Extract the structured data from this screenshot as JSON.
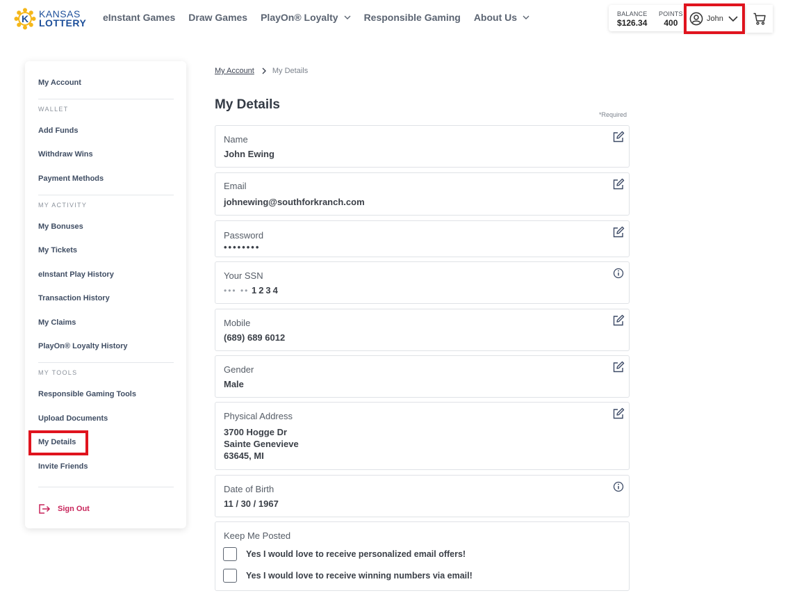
{
  "header": {
    "logo_top": "KANSAS",
    "logo_bottom": "LOTTERY",
    "nav": [
      {
        "label": "eInstant Games",
        "dropdown": false
      },
      {
        "label": "Draw Games",
        "dropdown": false
      },
      {
        "label": "PlayOn® Loyalty",
        "dropdown": true
      },
      {
        "label": "Responsible Gaming",
        "dropdown": false
      },
      {
        "label": "About Us",
        "dropdown": true
      }
    ],
    "balance_label": "BALANCE",
    "balance_value": "$126.34",
    "points_label": "POINTS",
    "points_value": "400",
    "user_name": "John",
    "icons": {
      "user": "user-circle-icon",
      "chevron": "chevron-down-icon",
      "cart": "cart-icon"
    }
  },
  "sidebar": {
    "my_account": "My Account",
    "wallet_label": "WALLET",
    "wallet_items": [
      "Add Funds",
      "Withdraw Wins",
      "Payment Methods"
    ],
    "activity_label": "MY ACTIVITY",
    "activity_items": [
      "My Bonuses",
      "My Tickets",
      "eInstant Play History",
      "Transaction History",
      "My Claims",
      "PlayOn® Loyalty History"
    ],
    "tools_label": "MY TOOLS",
    "tools_items": [
      "Responsible Gaming Tools",
      "Upload Documents",
      "My Details",
      "Invite Friends"
    ],
    "sign_out": "Sign Out"
  },
  "breadcrumb": {
    "parent": "My Account",
    "current": "My Details"
  },
  "main": {
    "title": "My Details",
    "required_note": "*Required",
    "fields": {
      "name": {
        "label": "Name",
        "value": "John Ewing"
      },
      "email": {
        "label": "Email",
        "value": "johnewing@southforkranch.com"
      },
      "password": {
        "label": "Password",
        "value": "••••••••"
      },
      "ssn": {
        "label": "Your SSN",
        "masked": "••• ••",
        "last4": "1234"
      },
      "mobile": {
        "label": "Mobile",
        "value": "(689) 689 6012"
      },
      "gender": {
        "label": "Gender",
        "value": "Male"
      },
      "address": {
        "label": "Physical Address",
        "line1": "3700 Hogge Dr",
        "line2": "Sainte Genevieve",
        "line3": "63645, MI"
      },
      "dob": {
        "label": "Date of Birth",
        "value": "11 / 30 / 1967"
      }
    },
    "keep_posted": {
      "label": "Keep Me Posted",
      "option1": "Yes I would love to receive personalized email offers!",
      "option2": "Yes I would love to receive winning numbers via email!"
    }
  },
  "colors": {
    "highlight": "#e0141e",
    "sign_out": "#c8245a",
    "brand_blue": "#1d4f9a",
    "brand_yellow": "#f5b71a"
  }
}
